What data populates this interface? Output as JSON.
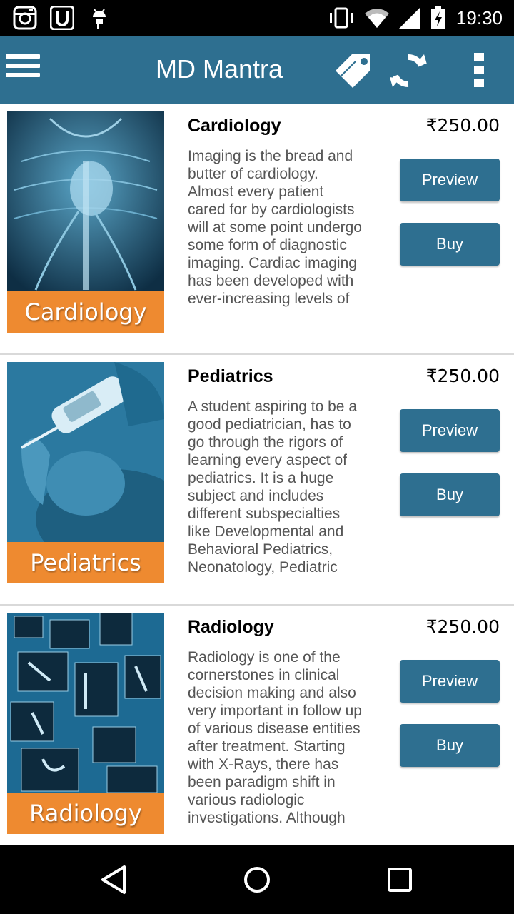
{
  "status_bar": {
    "time": "19:30",
    "left_icons": [
      "instagram-icon",
      "u-app-icon",
      "android-icon"
    ],
    "right_icons": [
      "vibrate-icon",
      "wifi-icon",
      "signal-icon",
      "battery-charging-icon"
    ]
  },
  "app_bar": {
    "title": "MD Mantra",
    "icons": [
      "menu-icon",
      "tag-icon",
      "refresh-icon",
      "overflow-menu-icon"
    ]
  },
  "items": [
    {
      "thumb_label": "Cardiology",
      "title": "Cardiology",
      "price": "₹250.00",
      "description": "Imaging is the bread and butter of cardiology. Almost every patient cared for by cardiologists will at some point undergo some form of diagnostic imaging. Cardiac imaging has been developed with ever-increasing levels of",
      "preview_label": "Preview",
      "buy_label": "Buy"
    },
    {
      "thumb_label": "Pediatrics",
      "title": "Pediatrics",
      "price": "₹250.00",
      "description": "A student aspiring to be a good pediatrician, has to go through the rigors of learning every aspect of pediatrics. It is a huge subject and includes different subspecialties like Developmental and Behavioral Pediatrics, Neonatology, Pediatric allergy and immunology",
      "preview_label": "Preview",
      "buy_label": "Buy"
    },
    {
      "thumb_label": "Radiology",
      "title": "Radiology",
      "price": "₹250.00",
      "description": "Radiology is one of the cornerstones in clinical decision making and also very important in follow up of various disease entities after treatment. Starting with X-Rays, there has been paradigm shift in various radiologic investigations. Although many a times",
      "preview_label": "Preview",
      "buy_label": "Buy"
    }
  ],
  "nav_bar": {
    "icons": [
      "back-icon",
      "home-icon",
      "recents-icon"
    ]
  },
  "colors": {
    "app_bar": "#2e6f90",
    "button": "#2e6f90",
    "thumb_label_bg": "#ee8a30",
    "description_text": "#555555"
  }
}
